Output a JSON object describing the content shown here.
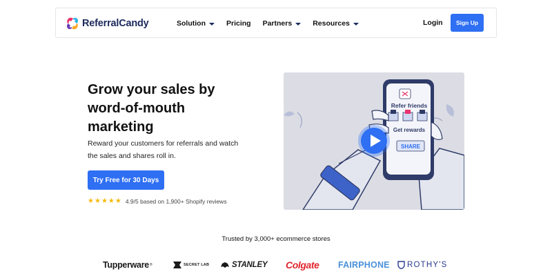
{
  "brand": {
    "name": "ReferralCandy",
    "logo_colors": [
      "#e8336d",
      "#2db3e5",
      "#f9a825",
      "#6a3fb5"
    ]
  },
  "nav": {
    "items": [
      {
        "label": "Solution",
        "dropdown": true
      },
      {
        "label": "Pricing",
        "dropdown": false
      },
      {
        "label": "Partners",
        "dropdown": true
      },
      {
        "label": "Resources",
        "dropdown": true
      }
    ],
    "login_label": "Login",
    "signup_label": "Sign Up"
  },
  "hero": {
    "title": "Grow your sales by word-of-mouth marketing",
    "subtitle": "Reward your customers for referrals and watch the sales and shares roll in.",
    "cta_label": "Try Free for 30 Days",
    "rating": {
      "stars": 5,
      "text": "4.9/5 based on 1,900+ Shopify reviews"
    }
  },
  "video": {
    "screen_title": "Refer friends",
    "screen_subtitle": "Get rewards",
    "share_label": "SHARE"
  },
  "trusted": {
    "label": "Trusted by 3,000+ ecommerce stores",
    "brands": [
      "Tupperware",
      "SECRET LAB",
      "STANLEY",
      "Colgate",
      "FAIRPHONE",
      "ROTHY'S"
    ]
  },
  "colors": {
    "accent": "#2e6ff3",
    "text": "#111111",
    "navy": "#1b2a5c",
    "star": "#f5b90a"
  }
}
